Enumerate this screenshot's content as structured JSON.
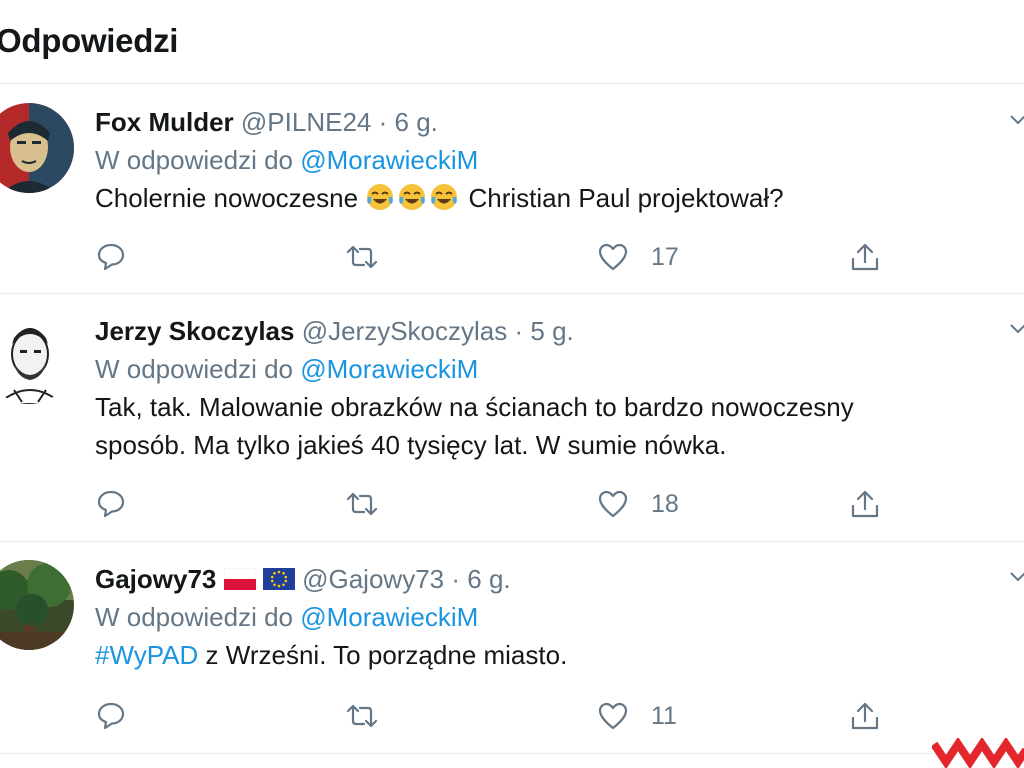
{
  "header": {
    "title": "Odpowiedzi"
  },
  "replying_prefix": "W odpowiedzi do",
  "tweets": [
    {
      "name": "Fox Mulder",
      "handle": "@PILNE24",
      "separator": "·",
      "time": "6 g.",
      "reply_to": "@MorawieckiM",
      "text_before": "Cholernie nowoczesne",
      "emoji": [
        "😂",
        "😂",
        "😂"
      ],
      "text_after": "Christian Paul projektował?",
      "likes": "17"
    },
    {
      "name": "Jerzy Skoczylas",
      "handle": "@JerzySkoczylas",
      "separator": "·",
      "time": "5 g.",
      "reply_to": "@MorawieckiM",
      "text_line1": "Tak, tak. Malowanie obrazków na ścianach to bardzo nowoczesny",
      "text_line2": "sposób. Ma tylko jakieś 40 tysięcy lat. W sumie nówka.",
      "likes": "18"
    },
    {
      "name": "Gajowy73",
      "handle": "@Gajowy73",
      "separator": "·",
      "time": "6 g.",
      "reply_to": "@MorawieckiM",
      "hashtag": "#WyPAD",
      "text_after": "z Wrześni. To porządne miasto.",
      "likes": "11"
    }
  ],
  "icons": {
    "reply": "reply-icon",
    "retweet": "retweet-icon",
    "like": "heart-icon",
    "share": "share-icon",
    "more": "chevron-down-icon"
  },
  "colors": {
    "link": "#1b95e0",
    "muted": "#657786",
    "watermark": "#e3262c"
  }
}
